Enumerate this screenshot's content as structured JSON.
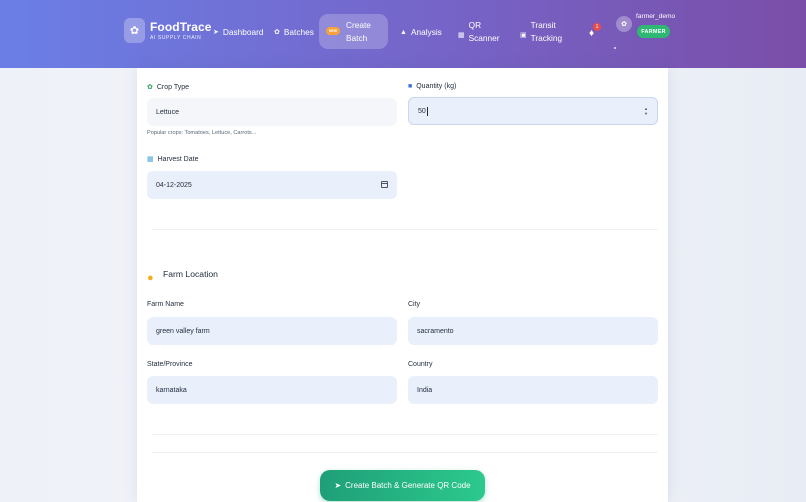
{
  "brand": {
    "title": "FoodTrace",
    "subtitle": "AI SUPPLY CHAIN",
    "logo_icon": "leaf-icon"
  },
  "nav": {
    "dashboard": "Dashboard",
    "batches": "Batches",
    "create_batch_line1": "Create",
    "create_batch_line2": "Batch",
    "new_badge": "NEW",
    "analysis": "Analysis",
    "qr_line1": "QR",
    "qr_line2": "Scanner",
    "transit_line1": "Transit",
    "transit_line2": "Tracking",
    "notification_count": "1"
  },
  "user": {
    "name": "farmer_demo",
    "role": "FARMER"
  },
  "form": {
    "crop_type_label": "Crop Type",
    "crop_type_value": "Lettuce",
    "crop_hint": "Popular crops: Tomatoes, Lettuce, Carrots...",
    "quantity_label": "Quantity (kg)",
    "quantity_value": "50",
    "harvest_label": "Harvest Date",
    "harvest_value": "04-12-2025"
  },
  "location": {
    "section_title": "Farm Location",
    "farm_name_label": "Farm Name",
    "farm_name_value": "green valley farm",
    "city_label": "City",
    "city_value": "sacramento",
    "state_label": "State/Province",
    "state_value": "karnataka",
    "country_label": "Country",
    "country_value": "India"
  },
  "submit_label": "Create Batch & Generate QR Code",
  "colors": {
    "accent_green": "#2cc98d",
    "nav_start": "#6a7fe6",
    "nav_end": "#7a4ea8",
    "role_badge": "#2fb873",
    "pin": "#f2b01e"
  }
}
